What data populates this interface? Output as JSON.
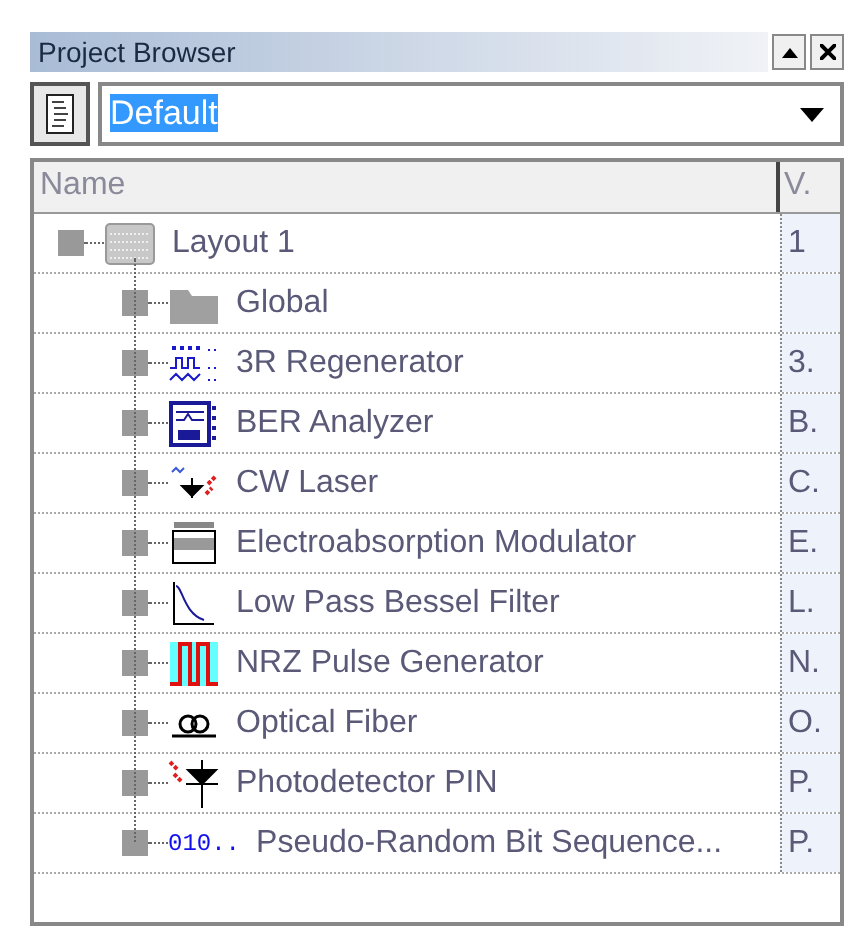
{
  "panel": {
    "title": "Project Browser"
  },
  "view_select": {
    "value": "Default"
  },
  "table": {
    "columns": [
      "Name",
      "V."
    ],
    "rows": [
      {
        "name": "Layout 1",
        "v": "1",
        "children": [
          {
            "name": "Global"
          },
          {
            "name": "3R Regenerator",
            "v": "3."
          },
          {
            "name": "BER Analyzer",
            "v": "B."
          },
          {
            "name": "CW Laser",
            "v": "C."
          },
          {
            "name": "Electroabsorption Modulator",
            "v": "E."
          },
          {
            "name": "Low Pass Bessel Filter",
            "v": "L."
          },
          {
            "name": "NRZ Pulse Generator",
            "v": "N."
          },
          {
            "name": "Optical Fiber",
            "v": "O."
          },
          {
            "name": "Photodetector PIN",
            "v": "P."
          },
          {
            "name": "Pseudo-Random Bit Sequence...",
            "v": "P.",
            "icon_text": "010.."
          }
        ]
      }
    ]
  }
}
